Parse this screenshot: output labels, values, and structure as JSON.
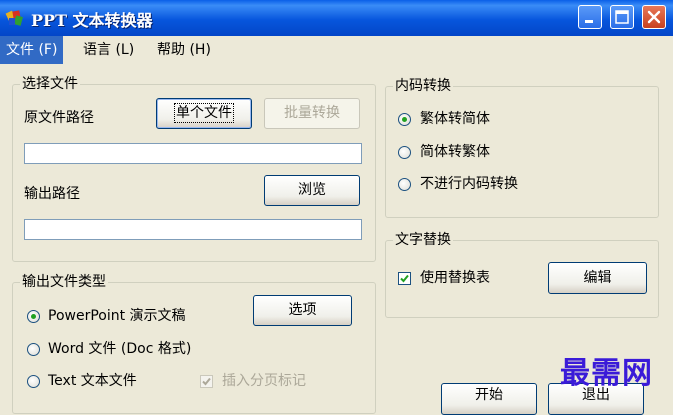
{
  "window": {
    "title": "PPT 文本转换器",
    "minimize_icon": "minimize-icon",
    "maximize_icon": "maximize-icon",
    "close_icon": "close-icon"
  },
  "menu": [
    {
      "label": "文件 (F)",
      "active": true
    },
    {
      "label": "语言 (L)",
      "active": false
    },
    {
      "label": "帮助 (H)",
      "active": false
    }
  ],
  "select_file": {
    "legend": "选择文件",
    "source_path_label": "原文件路径",
    "single_file_button": "单个文件",
    "batch_convert_button": "批量转换",
    "source_path_value": "",
    "output_path_label": "输出路径",
    "browse_button": "浏览",
    "output_path_value": ""
  },
  "output_type": {
    "legend": "输出文件类型",
    "options_button": "选项",
    "options": [
      {
        "label": "PowerPoint 演示文稿",
        "selected": true
      },
      {
        "label": "Word 文件 (Doc 格式)",
        "selected": false
      },
      {
        "label": "Text 文本文件",
        "selected": false
      }
    ],
    "insert_page_break": {
      "label": "插入分页标记",
      "checked": true,
      "enabled": false
    }
  },
  "encoding": {
    "legend": "内码转换",
    "options": [
      {
        "label": "繁体转简体",
        "selected": true
      },
      {
        "label": "简体转繁体",
        "selected": false
      },
      {
        "label": "不进行内码转换",
        "selected": false
      }
    ]
  },
  "text_replace": {
    "legend": "文字替换",
    "use_table": {
      "label": "使用替换表",
      "checked": true
    },
    "edit_button": "编辑"
  },
  "footer": {
    "start_button": "开始",
    "exit_button": "退出"
  },
  "watermark": "最需网",
  "colors": {
    "titlebar": "#0756dd",
    "menu_highlight": "#316ac5",
    "window_bg": "#ece9d8",
    "radio_dot": "#21a121",
    "watermark": "#3a1bd8"
  }
}
